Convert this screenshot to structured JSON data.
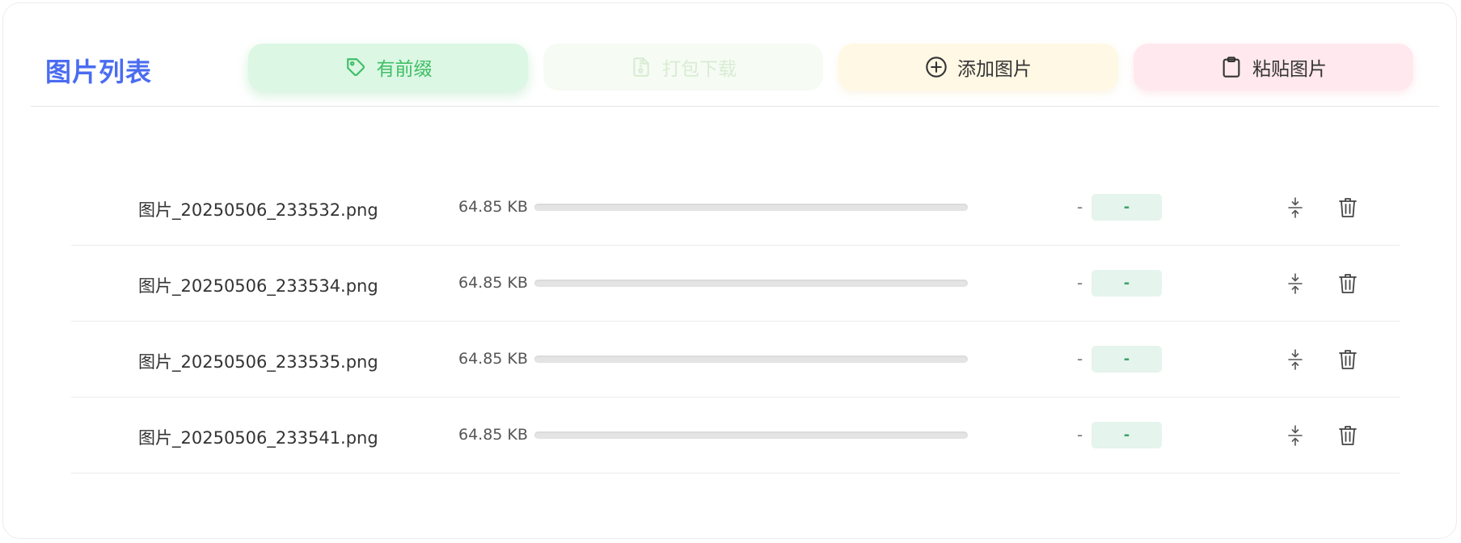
{
  "header": {
    "title": "图片列表",
    "buttons": {
      "prefix": {
        "label": "有前缀",
        "icon": "tag-icon"
      },
      "download": {
        "label": "打包下载",
        "icon": "zip-file-icon",
        "disabled": true
      },
      "add": {
        "label": "添加图片",
        "icon": "plus-circle-icon"
      },
      "paste": {
        "label": "粘贴图片",
        "icon": "clipboard-icon"
      }
    }
  },
  "files": [
    {
      "name": "图片_20250506_233532.png",
      "size": "64.85 KB",
      "progress": 0,
      "result_size": "-",
      "ratio": "-"
    },
    {
      "name": "图片_20250506_233534.png",
      "size": "64.85 KB",
      "progress": 0,
      "result_size": "-",
      "ratio": "-"
    },
    {
      "name": "图片_20250506_233535.png",
      "size": "64.85 KB",
      "progress": 0,
      "result_size": "-",
      "ratio": "-"
    },
    {
      "name": "图片_20250506_233541.png",
      "size": "64.85 KB",
      "progress": 0,
      "result_size": "-",
      "ratio": "-"
    }
  ],
  "row_actions": [
    "compress-icon",
    "trash-icon"
  ],
  "colors": {
    "title": "#4a6cf0",
    "prefix_bg": "#dcf7e4",
    "prefix_text": "#3fbf66",
    "download_bg": "#f6fbf4",
    "add_bg": "#fff8e4",
    "paste_bg": "#ffe8ee",
    "badge_bg": "#e5f4ec",
    "badge_text": "#3aa36b"
  }
}
